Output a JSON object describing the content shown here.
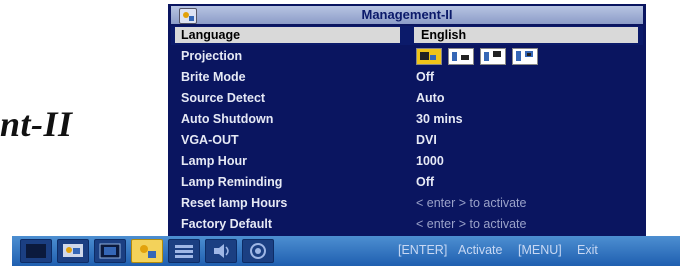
{
  "side_title": "nt-II",
  "osd": {
    "title": "Management-II",
    "items": [
      {
        "label": "Language",
        "value": "English",
        "selected": true
      },
      {
        "label": "Projection",
        "value": "",
        "type": "icons"
      },
      {
        "label": "Brite Mode",
        "value": "Off"
      },
      {
        "label": "Source Detect",
        "value": "Auto"
      },
      {
        "label": "Auto Shutdown",
        "value": "30 mins"
      },
      {
        "label": "VGA-OUT",
        "value": "DVI"
      },
      {
        "label": "Lamp Hour",
        "value": "1000"
      },
      {
        "label": "Lamp Reminding",
        "value": "Off"
      },
      {
        "label": "Reset lamp Hours",
        "value": "< enter > to activate",
        "dim": true
      },
      {
        "label": "Factory Default",
        "value": "< enter > to activate",
        "dim": true
      }
    ],
    "projection_icons": [
      "projection-front-desktop-icon",
      "projection-rear-desktop-icon",
      "projection-front-ceiling-icon",
      "projection-rear-ceiling-icon"
    ]
  },
  "bottombar": {
    "enter_key": "[ENTER]",
    "enter_action": "Activate",
    "menu_key": "[MENU]",
    "menu_action": "Exit",
    "icons": [
      "picture-icon",
      "computer-icon",
      "video-icon",
      "management-icon",
      "settings-list-icon",
      "audio-icon",
      "advanced-icon"
    ],
    "active_icon_index": 3
  },
  "colors": {
    "osd_bg": "#0a1560",
    "selection": "#d9d9d9",
    "bar": "#1f5fb0",
    "active": "#f3d25a"
  }
}
